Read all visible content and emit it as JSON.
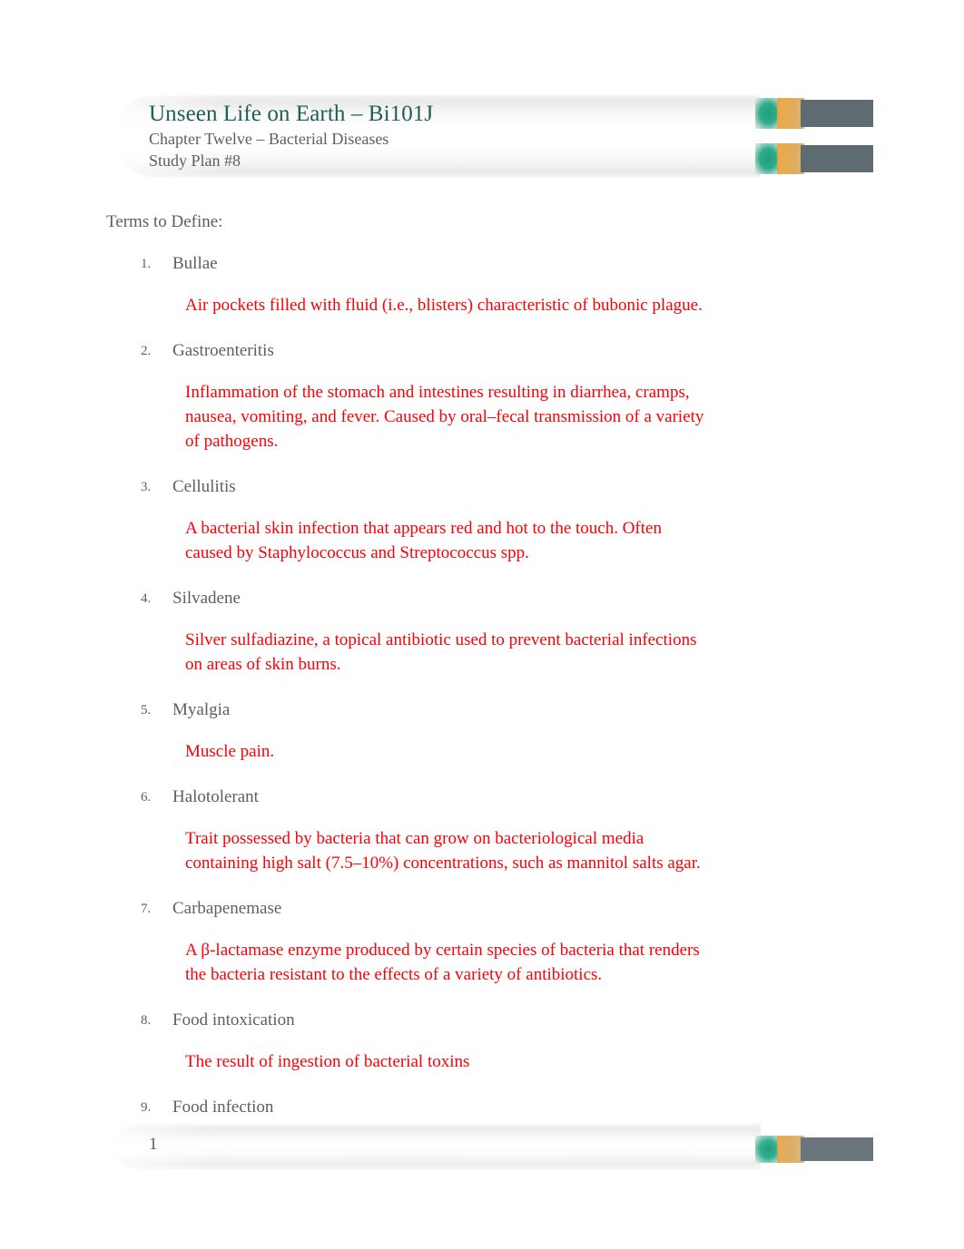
{
  "header": {
    "title": "Unseen Life on Earth – Bi101J",
    "subtitle_1": "Chapter Twelve – Bacterial Diseases",
    "subtitle_2": "Study Plan #8",
    "title_color": "#1d6152",
    "subtitle_color": "#5e5e5e"
  },
  "body": {
    "section_heading": "Terms to Define:",
    "definition_color": "#fb0007",
    "term_color": "#5e5e5e",
    "terms": [
      {
        "number": "1.",
        "name": "Bullae",
        "definition": "Air pockets filled with fluid (i.e., blisters) characteristic of bubonic plague."
      },
      {
        "number": "2.",
        "name": "Gastroenteritis",
        "definition": " Inflammation of the stomach and intestines resulting in diarrhea, cramps, nausea, vomiting, and fever. Caused by oral–fecal transmission of a variety of pathogens."
      },
      {
        "number": "3.",
        "name": "Cellulitis",
        "definition_part_1": "A bacterial skin infection that appears red and hot to the touch. Often caused by ",
        "definition_genus_1": "Staphylococcus",
        "definition_part_2": " and ",
        "definition_genus_2": "Streptococcus",
        "definition_part_3": " spp."
      },
      {
        "number": "4.",
        "name": "Silvadene",
        "definition": "Silver sulfadiazine, a topical antibiotic used to prevent bacterial infections on areas of skin burns."
      },
      {
        "number": "5.",
        "name": "Myalgia",
        "definition": "Muscle pain."
      },
      {
        "number": "6.",
        "name": "Halotolerant",
        "definition": "Trait possessed by bacteria that can grow on bacteriological media containing high salt (7.5–10%) concentrations, such as mannitol salts agar."
      },
      {
        "number": "7.",
        "name": "Carbapenemase",
        "definition": "A β-lactamase enzyme produced by certain species of bacteria that renders the bacteria resistant to the effects of a variety of antibiotics."
      },
      {
        "number": "8.",
        "name": "Food intoxication",
        "definition": "The result of ingestion of bacterial toxins"
      },
      {
        "number": "9.",
        "name": "Food infection",
        "definition": ""
      }
    ]
  },
  "footer": {
    "page_number": "1"
  },
  "decoration": {
    "green": "#2faa8b",
    "gold": "#e0a245",
    "gray": "#5e6b70"
  }
}
